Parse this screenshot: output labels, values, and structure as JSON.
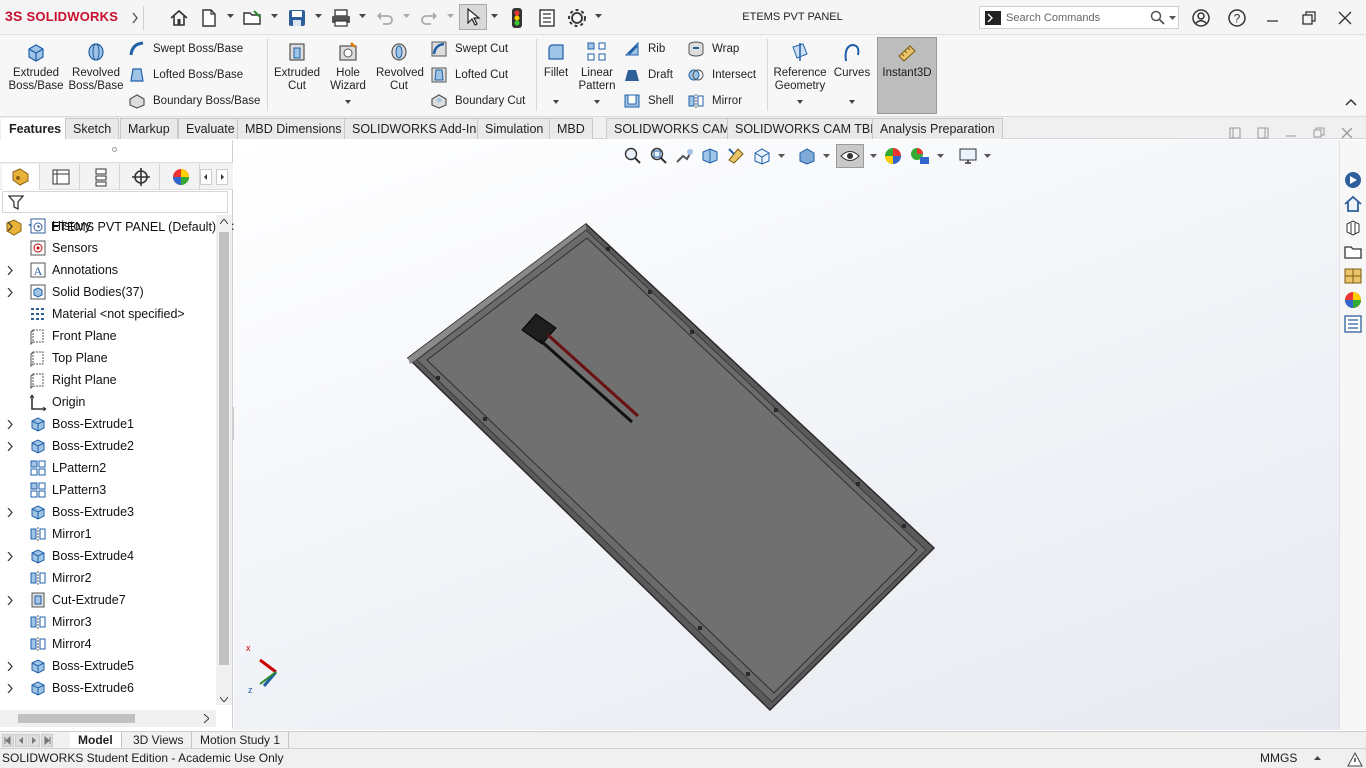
{
  "app": {
    "name": "SOLIDWORKS",
    "logo_prefix": "3S"
  },
  "title_bar": {
    "document_title": "ETEMS PVT PANEL",
    "search_placeholder": "Search Commands"
  },
  "ribbon": {
    "extruded_boss": "Extruded Boss/Base",
    "revolved_boss": "Revolved Boss/Base",
    "swept_boss": "Swept Boss/Base",
    "lofted_boss": "Lofted Boss/Base",
    "boundary_boss": "Boundary Boss/Base",
    "extruded_cut": "Extruded Cut",
    "hole_wizard": "Hole Wizard",
    "revolved_cut": "Revolved Cut",
    "swept_cut": "Swept Cut",
    "lofted_cut": "Lofted Cut",
    "boundary_cut": "Boundary Cut",
    "fillet": "Fillet",
    "linear_pattern": "Linear Pattern",
    "rib": "Rib",
    "draft": "Draft",
    "shell": "Shell",
    "wrap": "Wrap",
    "intersect": "Intersect",
    "mirror": "Mirror",
    "reference_geometry": "Reference Geometry",
    "curves": "Curves",
    "instant3d": "Instant3D"
  },
  "tabs": [
    "Features",
    "Sketch",
    "Markup",
    "Evaluate",
    "MBD Dimensions",
    "SOLIDWORKS Add-Ins",
    "Simulation",
    "MBD",
    "SOLIDWORKS CAM",
    "SOLIDWORKS CAM TBM",
    "Analysis Preparation"
  ],
  "active_tab": "Features",
  "tree": {
    "root": "ETEMS PVT PANEL  (Default) <<",
    "items": [
      {
        "label": "History",
        "icon": "history-icon",
        "expandable": true
      },
      {
        "label": "Sensors",
        "icon": "sensors-icon",
        "expandable": false
      },
      {
        "label": "Annotations",
        "icon": "annotations-icon",
        "expandable": true
      },
      {
        "label": "Solid Bodies(37)",
        "icon": "solid-bodies-icon",
        "expandable": true
      },
      {
        "label": "Material <not specified>",
        "icon": "material-icon",
        "expandable": false
      },
      {
        "label": "Front Plane",
        "icon": "plane-icon",
        "expandable": false
      },
      {
        "label": "Top Plane",
        "icon": "plane-icon",
        "expandable": false
      },
      {
        "label": "Right Plane",
        "icon": "plane-icon",
        "expandable": false
      },
      {
        "label": "Origin",
        "icon": "origin-icon",
        "expandable": false
      },
      {
        "label": "Boss-Extrude1",
        "icon": "extrude-icon",
        "expandable": true
      },
      {
        "label": "Boss-Extrude2",
        "icon": "extrude-icon",
        "expandable": true
      },
      {
        "label": "LPattern2",
        "icon": "pattern-icon",
        "expandable": false
      },
      {
        "label": "LPattern3",
        "icon": "pattern-icon",
        "expandable": false
      },
      {
        "label": "Boss-Extrude3",
        "icon": "extrude-icon",
        "expandable": true
      },
      {
        "label": "Mirror1",
        "icon": "mirror-icon",
        "expandable": false
      },
      {
        "label": "Boss-Extrude4",
        "icon": "extrude-icon",
        "expandable": true
      },
      {
        "label": "Mirror2",
        "icon": "mirror-icon",
        "expandable": false
      },
      {
        "label": "Cut-Extrude7",
        "icon": "cut-icon",
        "expandable": true
      },
      {
        "label": "Mirror3",
        "icon": "mirror-icon",
        "expandable": false
      },
      {
        "label": "Mirror4",
        "icon": "mirror-icon",
        "expandable": false
      },
      {
        "label": "Boss-Extrude5",
        "icon": "extrude-icon",
        "expandable": true
      },
      {
        "label": "Boss-Extrude6",
        "icon": "extrude-icon",
        "expandable": true
      }
    ]
  },
  "triad": {
    "x_label": "x",
    "z_label": "z"
  },
  "bottom_tabs": [
    "Model",
    "3D Views",
    "Motion Study 1"
  ],
  "status": {
    "left": "SOLIDWORKS Student Edition - Academic Use Only",
    "units": "MMGS"
  },
  "colors": {
    "brand": "#c8102e",
    "panel": "#6b6b6b",
    "panel_edge": "#3a3a3a",
    "accent": "#1f5fa8"
  }
}
